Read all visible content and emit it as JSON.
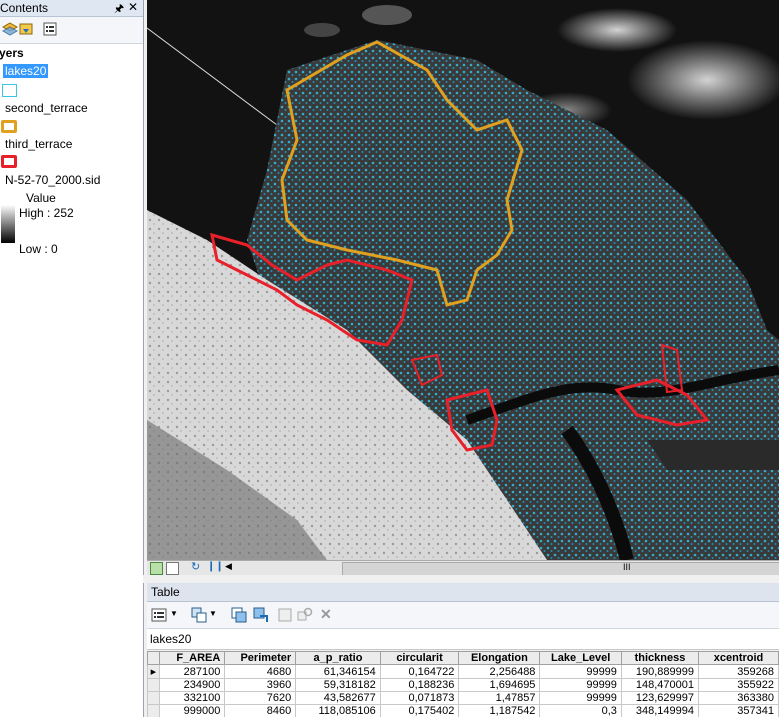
{
  "toc": {
    "title": "Contents",
    "layers_header": "yers",
    "layers": [
      {
        "name": "lakes20"
      },
      {
        "name": "second_terrace"
      },
      {
        "name": "third_terrace"
      },
      {
        "name": "N-52-70_2000.sid"
      }
    ],
    "raster_legend": {
      "field": "Value",
      "high": "High : 252",
      "low": "Low : 0"
    },
    "colors": {
      "lakes20": "#37c6e3",
      "second_terrace": "#e0a020",
      "third_terrace": "#e8202a"
    }
  },
  "map_toolbar": {
    "scroll_marker": "III"
  },
  "table_window": {
    "title": "Table",
    "table_name": "lakes20",
    "columns": [
      "F_AREA",
      "Perimeter",
      "a_p_ratio",
      "circularit",
      "Elongation",
      "Lake_Level",
      "thickness",
      "xcentroid"
    ],
    "rows": [
      {
        "current": true,
        "cells": [
          "287100",
          "4680",
          "61,346154",
          "0,164722",
          "2,256488",
          "99999",
          "190,889999",
          "359268"
        ]
      },
      {
        "current": false,
        "cells": [
          "234900",
          "3960",
          "59,318182",
          "0,188236",
          "1,694695",
          "99999",
          "148,470001",
          "355922"
        ]
      },
      {
        "current": false,
        "cells": [
          "332100",
          "7620",
          "43,582677",
          "0,071873",
          "1,47857",
          "99999",
          "123,629997",
          "363380"
        ]
      },
      {
        "current": false,
        "cells": [
          "999000",
          "8460",
          "118,085106",
          "0,175402",
          "1,187542",
          "0,3",
          "348,149994",
          "357341"
        ]
      }
    ]
  }
}
